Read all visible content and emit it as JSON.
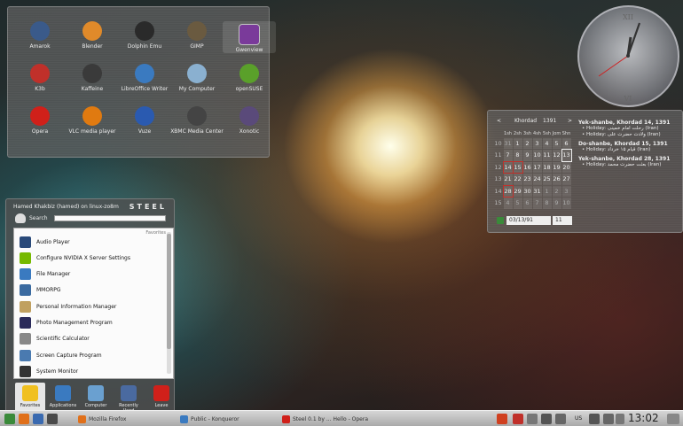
{
  "folder_view": {
    "apps": [
      {
        "label": "Amarok",
        "color": "#3a5a8a",
        "icon": "amarok-icon"
      },
      {
        "label": "Blender",
        "color": "#e08a2a",
        "icon": "blender-icon"
      },
      {
        "label": "Dolphin Emu",
        "color": "#2a2a2a",
        "icon": "dolphin-emu-icon"
      },
      {
        "label": "GIMP",
        "color": "#6a5a40",
        "icon": "gimp-icon"
      },
      {
        "label": "Gwenview",
        "color": "#7a3a9a",
        "icon": "gwenview-icon"
      },
      {
        "label": "K3b",
        "color": "#c0302a",
        "icon": "k3b-icon"
      },
      {
        "label": "Kaffeine",
        "color": "#3a3a3a",
        "icon": "kaffeine-icon"
      },
      {
        "label": "LibreOffice Writer",
        "color": "#3a7ac0",
        "icon": "libreoffice-writer-icon"
      },
      {
        "label": "My Computer",
        "color": "#8ab0d0",
        "icon": "computer-icon"
      },
      {
        "label": "openSUSE",
        "color": "#5aa02a",
        "icon": "opensuse-icon"
      },
      {
        "label": "Opera",
        "color": "#d0201a",
        "icon": "opera-icon"
      },
      {
        "label": "VLC media player",
        "color": "#e07a10",
        "icon": "vlc-icon"
      },
      {
        "label": "Vuze",
        "color": "#2a5ab0",
        "icon": "vuze-icon"
      },
      {
        "label": "XBMC Media Center",
        "color": "#444444",
        "icon": "xbmc-icon"
      },
      {
        "label": "Xonotic",
        "color": "#5a4a7a",
        "icon": "xonotic-icon"
      }
    ]
  },
  "clock": {
    "numeral_top": "XII",
    "numeral_bottom": "VI"
  },
  "calendar": {
    "month": "Khordad",
    "year": "1391",
    "weekdays": [
      "1sh",
      "2sh",
      "3sh",
      "4sh",
      "5sh",
      "Jom",
      "Shn"
    ],
    "weeks": [
      {
        "wk": "10",
        "days": [
          "31",
          "1",
          "2",
          "3",
          "4",
          "5",
          "6"
        ]
      },
      {
        "wk": "11",
        "days": [
          "7",
          "8",
          "9",
          "10",
          "11",
          "12",
          "13"
        ]
      },
      {
        "wk": "12",
        "days": [
          "14",
          "15",
          "16",
          "17",
          "18",
          "19",
          "20"
        ]
      },
      {
        "wk": "13",
        "days": [
          "21",
          "22",
          "23",
          "24",
          "25",
          "26",
          "27"
        ]
      },
      {
        "wk": "14",
        "days": [
          "28",
          "29",
          "30",
          "31",
          "1",
          "2",
          "3"
        ]
      },
      {
        "wk": "15",
        "days": [
          "4",
          "5",
          "6",
          "7",
          "8",
          "9",
          "10"
        ]
      }
    ],
    "date_field": "03/13/91",
    "week_field": "11",
    "events": [
      {
        "title": "Yek-shanbe, Khordad 14, 1391",
        "items": [
          "• Holiday: رحلت امام خمینی (Iran)",
          "• Holiday: ولادت حضرت علی (Iran)"
        ]
      },
      {
        "title": "Do-shanbe, Khordad 15, 1391",
        "items": [
          "• Holiday: قیام ۱۵ خرداد (Iran)"
        ]
      },
      {
        "title": "Yek-shanbe, Khordad 28, 1391",
        "items": [
          "• Holiday: بعثت حضرت محمد (Iran)"
        ]
      }
    ]
  },
  "kickoff": {
    "user": "Hamed Khakbiz (hamed) on linux-zo8m",
    "theme": "STEEL",
    "search_label": "Search",
    "favorites_label": "Favorites",
    "items": [
      {
        "label": "Audio Player",
        "color": "#2a4a7a",
        "icon": "audio-player-icon"
      },
      {
        "label": "Configure NVIDIA X Server Settings",
        "color": "#76b900",
        "icon": "nvidia-icon"
      },
      {
        "label": "File Manager",
        "color": "#3a7ac0",
        "icon": "file-manager-icon"
      },
      {
        "label": "MMORPG",
        "color": "#3a6aa0",
        "icon": "mmorpg-icon"
      },
      {
        "label": "Personal Information Manager",
        "color": "#c0a060",
        "icon": "pim-icon"
      },
      {
        "label": "Photo Management Program",
        "color": "#2a2a5a",
        "icon": "photo-icon"
      },
      {
        "label": "Scientific Calculator",
        "color": "#888888",
        "icon": "calculator-icon"
      },
      {
        "label": "Screen Capture Program",
        "color": "#4a7ab0",
        "icon": "screen-capture-icon"
      },
      {
        "label": "System Monitor",
        "color": "#333333",
        "icon": "system-monitor-icon"
      }
    ],
    "tabs": [
      {
        "label": "Favorites",
        "color": "#f0c020",
        "icon": "star-icon"
      },
      {
        "label": "Applications",
        "color": "#3a7ac0",
        "icon": "applications-icon"
      },
      {
        "label": "Computer",
        "color": "#6aa0d0",
        "icon": "computer-icon"
      },
      {
        "label": "Recently Used",
        "color": "#4a6aa0",
        "icon": "recent-icon"
      },
      {
        "label": "Leave",
        "color": "#d0201a",
        "icon": "power-icon"
      }
    ]
  },
  "taskbar": {
    "tasks": [
      {
        "label": "Mozilla Firefox",
        "color": "#e0701a",
        "icon": "firefox-icon"
      },
      {
        "label": "Public - Konqueror",
        "color": "#3a7ac0",
        "icon": "konqueror-icon"
      },
      {
        "label": "Steel 0.1 by ... Hello - Opera",
        "color": "#d0201a",
        "icon": "opera-icon"
      }
    ],
    "language": "US",
    "time": "13:02"
  }
}
